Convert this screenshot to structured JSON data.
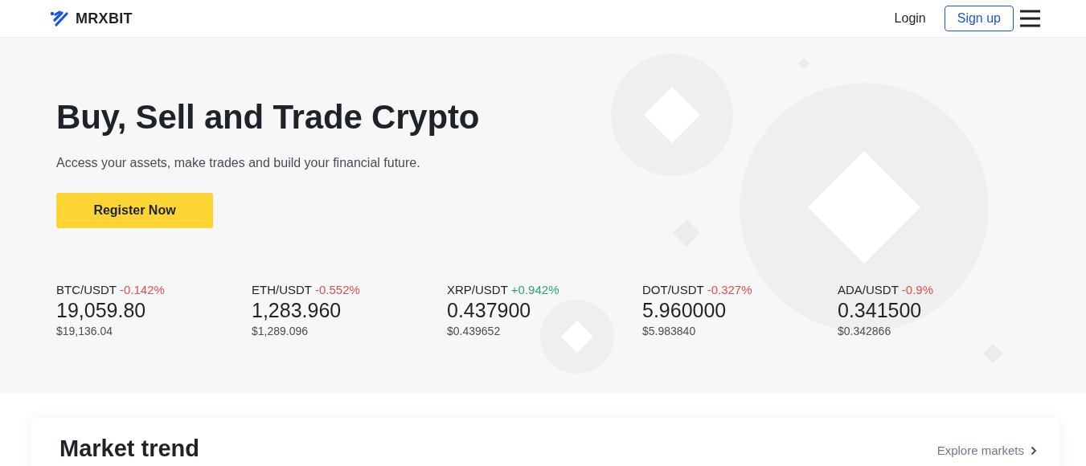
{
  "header": {
    "brand": "MRXBIT",
    "login": "Login",
    "signup": "Sign up"
  },
  "hero": {
    "title": "Buy, Sell and Trade Crypto",
    "subtitle": "Access your assets, make trades and build your financial future.",
    "cta": "Register Now"
  },
  "tickers": [
    {
      "pair": "BTC/USDT",
      "change": "-0.142%",
      "color": "#d9534f",
      "price": "19,059.80",
      "usd": "$19,136.04"
    },
    {
      "pair": "ETH/USDT",
      "change": "-0.552%",
      "color": "#d9534f",
      "price": "1,283.960",
      "usd": "$1,289.096"
    },
    {
      "pair": "XRP/USDT",
      "change": "+0.942%",
      "color": "#2ea66b",
      "price": "0.437900",
      "usd": "$0.439652"
    },
    {
      "pair": "DOT/USDT",
      "change": "-0.327%",
      "color": "#d9534f",
      "price": "5.960000",
      "usd": "$5.983840"
    },
    {
      "pair": "ADA/USDT",
      "change": "-0.9%",
      "color": "#d9534f",
      "price": "0.341500",
      "usd": "$0.342866"
    }
  ],
  "market": {
    "title": "Market trend",
    "link": "Explore markets"
  }
}
